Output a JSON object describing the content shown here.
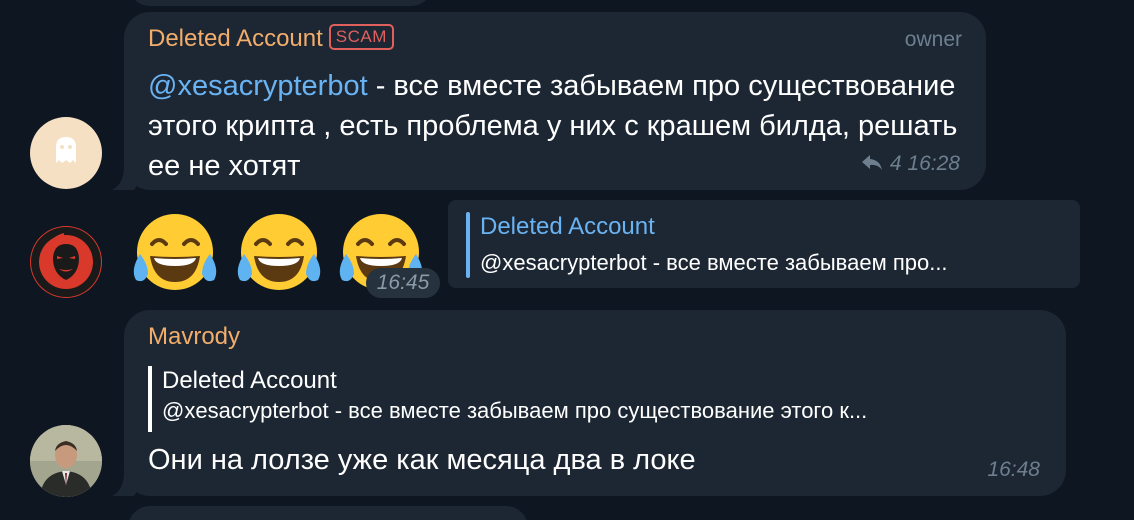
{
  "colors": {
    "background": "#0e1621",
    "bubble": "#1d2733",
    "sender_orange": "#f3ad6b",
    "link_blue": "#6ab3f3",
    "scam_red": "#e0605e",
    "meta_gray": "#6d7f8f"
  },
  "message1": {
    "sender": "Deleted Account",
    "badge": "SCAM",
    "role": "owner",
    "mention": "@xesacrypterbot",
    "text_after_mention": " - все вместе забываем про существование этого крипта , есть проблема у них с крашем билда, решать ее не хотят",
    "replies": "4",
    "time": "16:28",
    "avatar_icon": "ghost-icon"
  },
  "message2": {
    "emojis": [
      "😂",
      "😂",
      "😂"
    ],
    "time": "16:45",
    "avatar_icon": "professor-mask-icon",
    "reply_to": {
      "name": "Deleted Account",
      "text": "@xesacrypterbot - все вместе забываем про..."
    }
  },
  "message3": {
    "sender": "Mavrody",
    "quote": {
      "name": "Deleted Account",
      "text": "@xesacrypterbot - все вместе забываем про существование этого к..."
    },
    "text": "Они на лолзе уже как месяца два в локе",
    "time": "16:48",
    "avatar_icon": "user-photo"
  }
}
